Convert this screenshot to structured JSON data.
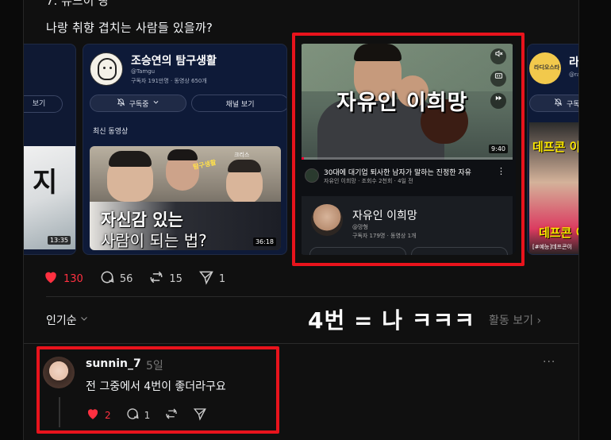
{
  "post": {
    "heading_partial": "7. 유느이 땅",
    "text": "나랑 취향 겹치는 사람들 있을까?"
  },
  "cards": {
    "card0": {
      "button": "보기",
      "thumb_text": "지",
      "duration": "13:35"
    },
    "card1": {
      "channel_name": "조승연의 탐구생활",
      "handle": "@Tamgu",
      "meta": "구독자 191만명 · 동영상 650개",
      "subscribed_label": "구독중",
      "view_channel_label": "채널 보기",
      "latest_label": "최신 동영상",
      "thumb_line1": "자신감 있는",
      "thumb_line2": "사람이 되는 법?",
      "thumb_tag": "탐구생활",
      "thumb_tag2": "크리스",
      "duration": "36:18"
    },
    "card2": {
      "video_title_overlay": "자유인 이희망",
      "duration": "9:40",
      "progress": 0.01,
      "video_title": "30대에 대기업 퇴사한 남자가 말하는 진정한 자유",
      "video_meta": "자유인 이희망 · 조회수 2천회 · 4일 전",
      "channel_name": "자유인 이희망",
      "handle": "@망형",
      "meta": "구독자 179명 · 동영상 1개"
    },
    "card3": {
      "channel_name": "라디",
      "handle": "@rac",
      "subscribed_label": "구독중",
      "avatar_text": "라디오스타",
      "thumb_line1": "데프콘 이",
      "thumb_line2": "데프콘 이",
      "thumb_line3": "[#예능]데프콘이"
    }
  },
  "actions": {
    "likes": "130",
    "comments": "56",
    "reposts": "15",
    "shares": "1"
  },
  "sort": {
    "label": "인기순",
    "activity_label": "활동 보기"
  },
  "overlay_text": "4번 = 나 ㅋㅋㅋ",
  "reply": {
    "username": "sunnin_7",
    "time": "5일",
    "text": "전 그중에서 4번이 좋더라구요",
    "likes": "2",
    "comments": "1",
    "more": "···"
  },
  "colors": {
    "background": "#101010",
    "like_red": "#ff3040",
    "highlight_red": "#e8131c",
    "card_navy": "#0e1a38"
  },
  "icons": [
    "heart-icon",
    "comment-icon",
    "repost-icon",
    "share-icon",
    "bell-icon",
    "chevron-down-icon",
    "mute-icon",
    "captions-icon",
    "next-icon",
    "more-icon"
  ]
}
